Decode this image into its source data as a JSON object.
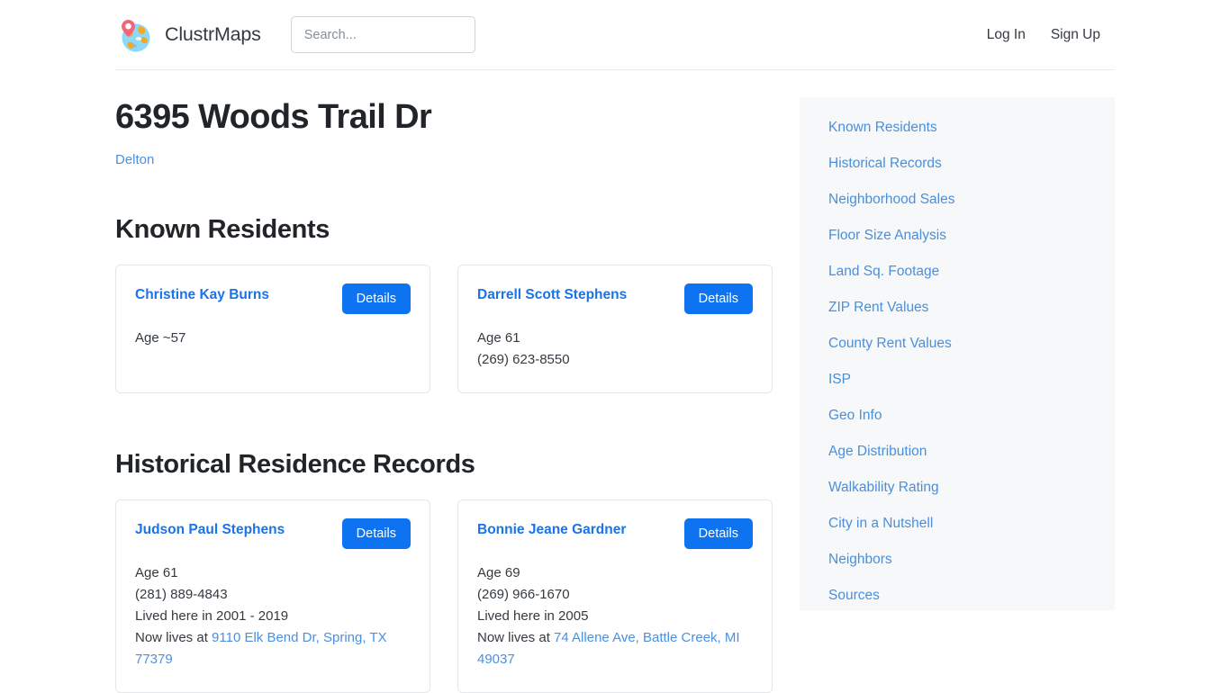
{
  "header": {
    "brand_name": "ClustrMaps",
    "logo_icon": "globe-pin-icon",
    "search": {
      "value": "",
      "placeholder": "Search..."
    },
    "login_label": "Log In",
    "signup_label": "Sign Up"
  },
  "page": {
    "title": "6395 Woods Trail Dr",
    "city_link": "Delton"
  },
  "sections": {
    "residents_heading": "Known Residents",
    "historical_heading": "Historical Residence Records",
    "details_label": "Details"
  },
  "known_residents": [
    {
      "name": "Christine Kay Burns",
      "age": "Age ~57",
      "phone": "",
      "lived": "",
      "now_lives_prefix": "",
      "now_lives_link": ""
    },
    {
      "name": "Darrell Scott Stephens",
      "age": "Age 61",
      "phone": "(269) 623-8550",
      "lived": "",
      "now_lives_prefix": "",
      "now_lives_link": ""
    }
  ],
  "historical_records": [
    {
      "name": "Judson Paul Stephens",
      "age": "Age 61",
      "phone": "(281) 889-4843",
      "lived": "Lived here in 2001 - 2019",
      "now_lives_prefix": "Now lives at ",
      "now_lives_link": "9110 Elk Bend Dr, Spring, TX 77379"
    },
    {
      "name": "Bonnie Jeane Gardner",
      "age": "Age 69",
      "phone": "(269) 966-1670",
      "lived": "Lived here in 2005",
      "now_lives_prefix": "Now lives at ",
      "now_lives_link": "74 Allene Ave, Battle Creek, MI 49037"
    }
  ],
  "sidebar": {
    "items": [
      {
        "label": "Known Residents"
      },
      {
        "label": "Historical Records"
      },
      {
        "label": "Neighborhood Sales"
      },
      {
        "label": "Floor Size Analysis"
      },
      {
        "label": "Land Sq. Footage"
      },
      {
        "label": "ZIP Rent Values"
      },
      {
        "label": "County Rent Values"
      },
      {
        "label": "ISP"
      },
      {
        "label": "Geo Info"
      },
      {
        "label": "Age Distribution"
      },
      {
        "label": "Walkability Rating"
      },
      {
        "label": "City in a Nutshell"
      },
      {
        "label": "Neighbors"
      },
      {
        "label": "Sources"
      }
    ]
  },
  "colors": {
    "accent_blue": "#0d73f0",
    "link_blue": "#4a90e2",
    "name_blue": "#1a73e8",
    "sidebar_bg": "#f6f8fa",
    "border": "#e4e6e8"
  }
}
